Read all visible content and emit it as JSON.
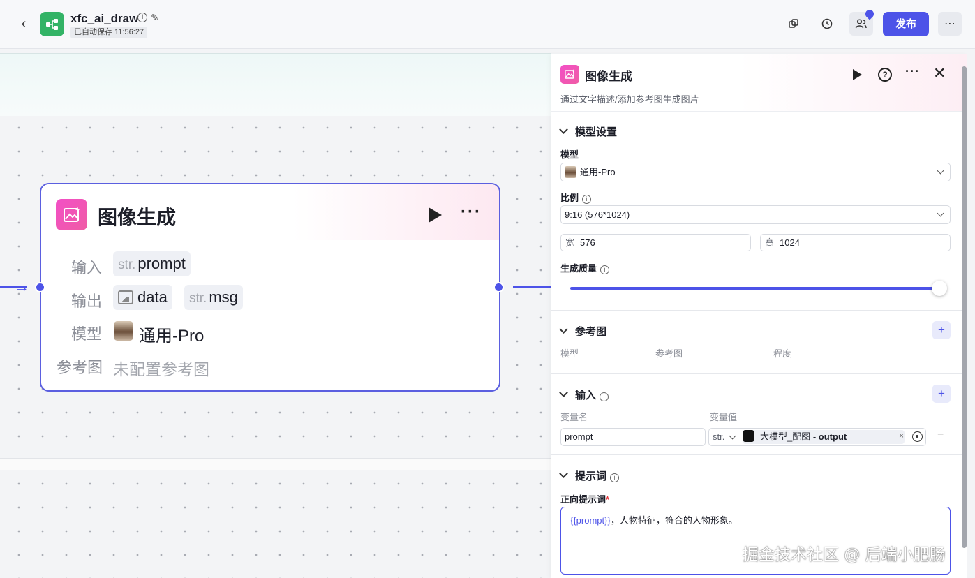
{
  "header": {
    "app_name": "xfc_ai_draw",
    "autosave": "已自动保存 11:56:27",
    "publish_label": "发布",
    "icons": [
      "back-icon",
      "app-workflow-icon",
      "info-icon",
      "edit-icon",
      "copy-icon",
      "history-icon",
      "collaborators-icon",
      "more-icon"
    ]
  },
  "node": {
    "title": "图像生成",
    "input_label": "输入",
    "input_param": {
      "type_prefix": "str.",
      "name": "prompt"
    },
    "output_label": "输出",
    "output_params": [
      {
        "type_prefix": "",
        "name": "data",
        "icon": "image-icon"
      },
      {
        "type_prefix": "str.",
        "name": "msg"
      }
    ],
    "model_label": "模型",
    "model_value": "通用-Pro",
    "reference_label": "参考图",
    "reference_value": "未配置参考图"
  },
  "panel": {
    "title": "图像生成",
    "description": "通过文字描述/添加参考图生成图片",
    "model_section": {
      "title": "模型设置",
      "model_label": "模型",
      "model_value": "通用-Pro",
      "ratio_label": "比例",
      "ratio_value": "9:16 (576*1024)",
      "width_label": "宽",
      "width_value": "576",
      "height_label": "高",
      "height_value": "1024",
      "quality_label": "生成质量",
      "quality_level": 1.0
    },
    "reference_section": {
      "title": "参考图",
      "columns": [
        "模型",
        "参考图",
        "程度"
      ]
    },
    "input_section": {
      "title": "输入",
      "col_name": "变量名",
      "col_value": "变量值",
      "var_name": "prompt",
      "var_type": "str.",
      "ref_source": "大模型_配图",
      "ref_separator": " - ",
      "ref_field": "output"
    },
    "prompt_section": {
      "title": "提示词",
      "positive_label": "正向提示词",
      "required_mark": "*",
      "prompt_var": "{{prompt}}",
      "prompt_text": "，人物特征，符合的人物形象。"
    }
  },
  "watermark": "掘金技术社区 @ 后端小肥肠",
  "colors": {
    "accent": "#4d53e8",
    "node_icon": "#f24fc6",
    "app_icon": "#33b366"
  }
}
